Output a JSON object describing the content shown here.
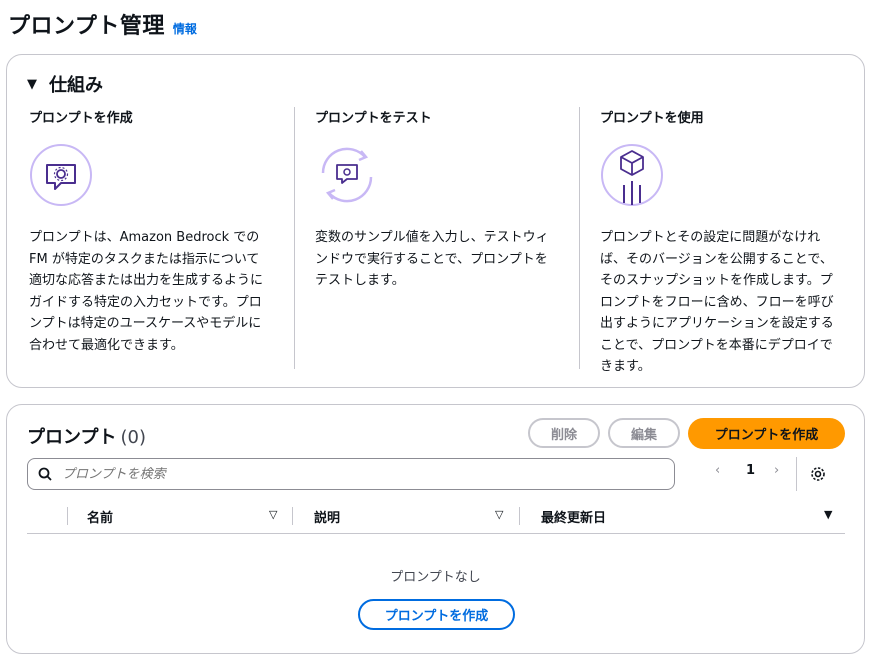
{
  "header": {
    "title": "プロンプト管理",
    "info": "情報"
  },
  "how_it_works": {
    "title": "仕組み",
    "columns": [
      {
        "title": "プロンプトを作成",
        "icon": "chat-gear-icon",
        "text": "プロンプトは、Amazon Bedrock での FM が特定のタスクまたは指示について適切な応答または出力を生成するようにガイドする特定の入力セットです。プロンプトは特定のユースケースやモデルに合わせて最適化できます。"
      },
      {
        "title": "プロンプトをテスト",
        "icon": "refresh-chat-icon",
        "text": "変数のサンプル値を入力し、テストウィンドウで実行することで、プロンプトをテストします。"
      },
      {
        "title": "プロンプトを使用",
        "icon": "cube-deploy-icon",
        "text": "プロンプトとその設定に問題がなければ、そのバージョンを公開することで、そのスナップショットを作成します。プロンプトをフローに含め、フローを呼び出すようにアプリケーションを設定することで、プロンプトを本番にデプロイできます。"
      }
    ]
  },
  "prompts": {
    "title": "プロンプト",
    "count": "(0)",
    "buttons": {
      "delete": "削除",
      "edit": "編集",
      "create": "プロンプトを作成"
    },
    "search": {
      "placeholder": "プロンプトを検索"
    },
    "pagination": {
      "page": "1"
    },
    "columns": [
      "名前",
      "説明",
      "最終更新日"
    ],
    "empty": {
      "text": "プロンプトなし",
      "button": "プロンプトを作成"
    }
  },
  "colors": {
    "accent": "#ff9900",
    "link": "#006ce0",
    "icon_purple": "#6842ff",
    "icon_ring": "#c8b8f5"
  }
}
